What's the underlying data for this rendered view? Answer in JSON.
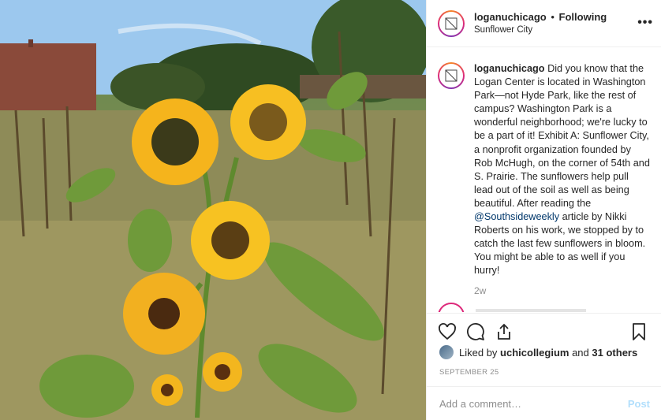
{
  "header": {
    "username": "loganuchicago",
    "separator": "•",
    "follow_status": "Following",
    "location": "Sunflower City",
    "more_label": "•••"
  },
  "caption": {
    "username": "loganuchicago",
    "text_before": "Did you know that the Logan Center is located in Washington Park—not Hyde Park, like the rest of campus? Washington Park is a wonderful neighborhood; we're lucky to be a part of it! Exhibit A: Sunflower City, a nonprofit organization founded by Rob McHugh, on the corner of 54th and S. Prairie. The sunflowers help pull lead out of the soil as well as being beautiful. After reading the ",
    "mention": "@Southsideweekly",
    "text_after": " article by Nikki Roberts on his work, we stopped by to catch the last few sunflowers in bloom. You might be able to as well if you hurry!",
    "time_ago": "2w"
  },
  "actions": {
    "like_icon": "heart-icon",
    "comment_icon": "comment-icon",
    "share_icon": "share-icon",
    "save_icon": "bookmark-icon"
  },
  "likes": {
    "prefix": "Liked by ",
    "user": "uchicollegium",
    "middle": " and ",
    "others": "31 others"
  },
  "date": "SEPTEMBER 25",
  "comment": {
    "placeholder": "Add a comment…",
    "post_label": "Post"
  },
  "colors": {
    "link": "#00376b",
    "post_disabled": "#b2dffc",
    "muted": "#8e8e8e",
    "story_ring": "#dd2a7b"
  }
}
